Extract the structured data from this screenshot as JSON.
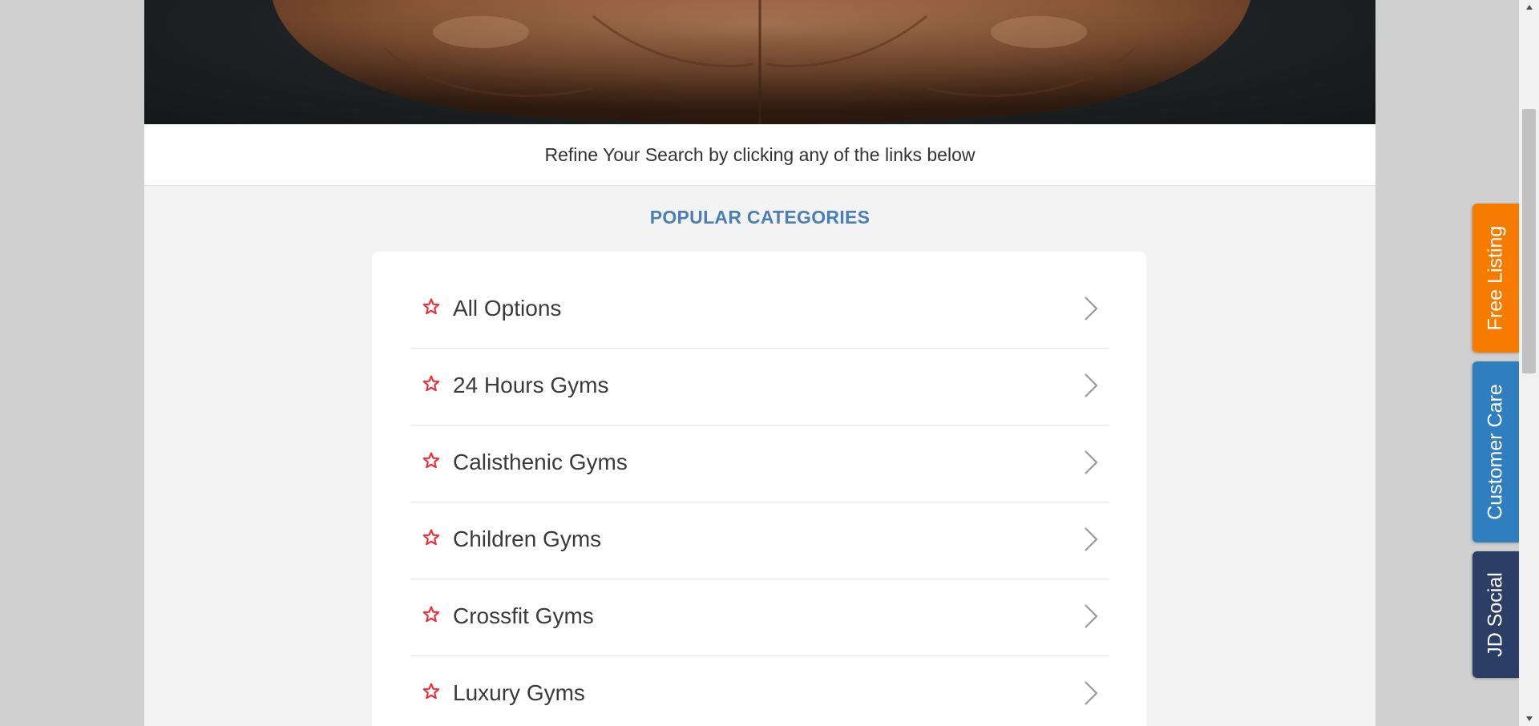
{
  "refine": {
    "text": "Refine Your Search by clicking any of the links below"
  },
  "popular": {
    "title": "POPULAR CATEGORIES",
    "items": [
      {
        "label": "All Options"
      },
      {
        "label": "24 Hours Gyms"
      },
      {
        "label": "Calisthenic Gyms"
      },
      {
        "label": "Children Gyms"
      },
      {
        "label": "Crossfit Gyms"
      },
      {
        "label": "Luxury Gyms"
      }
    ]
  },
  "side_tabs": {
    "free_listing": "Free Listing",
    "customer_care": "Customer Care",
    "jd_social": "JD Social"
  },
  "colors": {
    "accent_title": "#4a7fb5",
    "star": "#e8333c",
    "free_listing_tab": "#f57c00",
    "customer_care_tab": "#2f7ec0",
    "jd_social_tab": "#2b3f66"
  },
  "icons": {
    "item_icon": "star-outline-icon",
    "item_arrow": "chevron-right-icon"
  },
  "hero": {
    "image": "muscular-back-photo"
  }
}
